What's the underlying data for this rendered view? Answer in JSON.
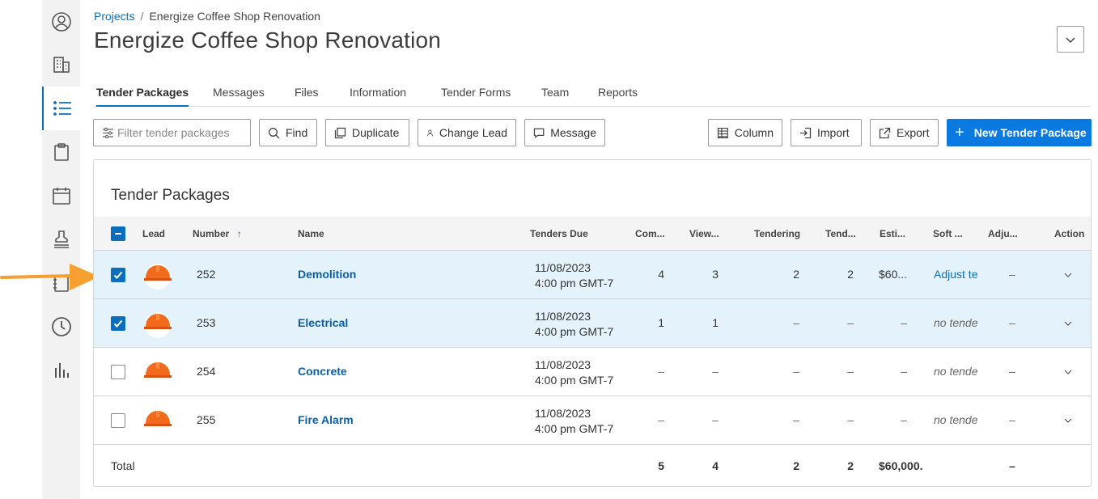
{
  "sidebar": {
    "icons": [
      "user-circle-icon",
      "building-icon",
      "list-icon",
      "clipboard-icon",
      "calendar-icon",
      "stamp-icon",
      "notebook-icon",
      "clock-icon",
      "bar-chart-icon"
    ]
  },
  "breadcrumb": {
    "root": "Projects",
    "separator": "/",
    "current": "Energize Coffee Shop Renovation"
  },
  "page": {
    "title": "Energize Coffee Shop Renovation"
  },
  "tabs": [
    {
      "label": "Tender Packages",
      "active": true
    },
    {
      "label": "Messages"
    },
    {
      "label": "Files"
    },
    {
      "label": "Information"
    },
    {
      "label": "Tender Forms"
    },
    {
      "label": "Team"
    },
    {
      "label": "Reports"
    }
  ],
  "toolbar": {
    "filter_placeholder": "Filter tender packages",
    "find": "Find",
    "duplicate": "Duplicate",
    "change_lead": "Change Lead",
    "message": "Message",
    "column": "Column",
    "import": "Import",
    "export": "Export",
    "new_package": "New Tender Package"
  },
  "table": {
    "title": "Tender Packages",
    "headers": {
      "lead": "Lead",
      "number": "Number",
      "name": "Name",
      "tenders_due": "Tenders Due",
      "committed": "Com...",
      "viewed": "View...",
      "tendering": "Tendering",
      "tendered": "Tend...",
      "estimate": "Esti...",
      "soft": "Soft ...",
      "adjusted": "Adju...",
      "action": "Action"
    },
    "rows": [
      {
        "selected": true,
        "number": "252",
        "name": "Demolition",
        "due_date": "11/08/2023",
        "due_time": "4:00 pm GMT-7",
        "committed": "4",
        "viewed": "3",
        "tendering": "2",
        "tendered": "2",
        "estimate": "$60...",
        "soft": "Adjust te",
        "adjusted": "–"
      },
      {
        "selected": true,
        "number": "253",
        "name": "Electrical",
        "due_date": "11/08/2023",
        "due_time": "4:00 pm GMT-7",
        "committed": "1",
        "viewed": "1",
        "tendering": "–",
        "tendered": "–",
        "estimate": "–",
        "soft": "no tende",
        "adjusted": "–"
      },
      {
        "selected": false,
        "number": "254",
        "name": "Concrete",
        "due_date": "11/08/2023",
        "due_time": "4:00 pm GMT-7",
        "committed": "–",
        "viewed": "–",
        "tendering": "–",
        "tendered": "–",
        "estimate": "–",
        "soft": "no tende",
        "adjusted": "–"
      },
      {
        "selected": false,
        "number": "255",
        "name": "Fire Alarm",
        "due_date": "11/08/2023",
        "due_time": "4:00 pm GMT-7",
        "committed": "–",
        "viewed": "–",
        "tendering": "–",
        "tendered": "–",
        "estimate": "–",
        "soft": "no tende",
        "adjusted": "–"
      }
    ],
    "total": {
      "label": "Total",
      "committed": "5",
      "viewed": "4",
      "tendering": "2",
      "tendered": "2",
      "estimate": "$60,000.",
      "adjusted": "–"
    }
  },
  "colors": {
    "accent": "#0a6ebd",
    "primary_button": "#0a7ae0",
    "selected_row": "#e3f2fb",
    "arrow": "#f5a031",
    "hardhat": "#f26a1b"
  }
}
